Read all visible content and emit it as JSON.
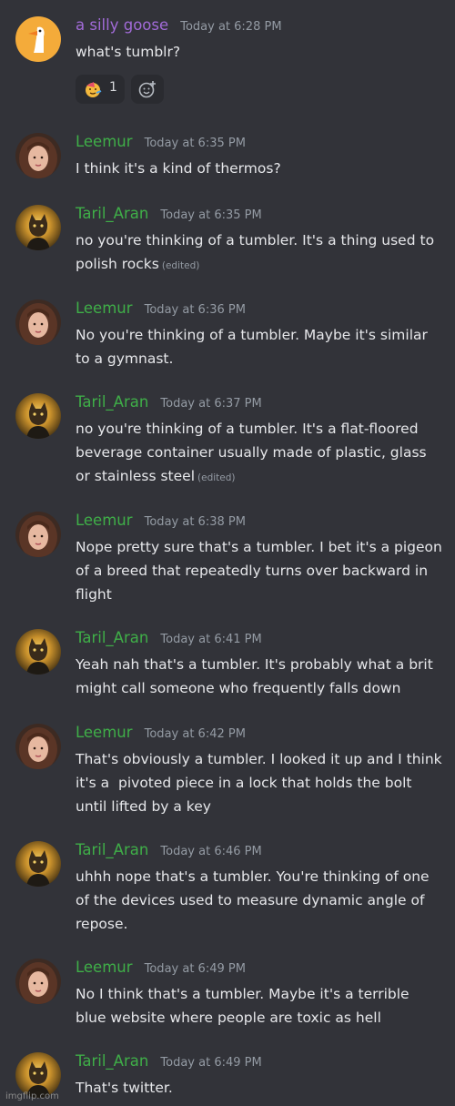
{
  "colors": {
    "background": "#323339",
    "name_goose": "#a26bd8",
    "name_green": "#3fae48",
    "text": "#e6e7ea",
    "timestamp": "#949ba4"
  },
  "messages": [
    {
      "author": "a silly goose",
      "avatar": "goose-avatar",
      "timestamp": "Today at 6:28 PM",
      "text": "what's tumblr?",
      "edited": "",
      "reactions": [
        {
          "emoji": "party-face-emoji",
          "count": "1"
        }
      ],
      "add_reaction_icon": "add-reaction-icon"
    },
    {
      "author": "Leemur",
      "avatar": "woman-avatar",
      "timestamp": "Today at 6:35 PM",
      "text": "I think it's a kind of thermos?",
      "edited": ""
    },
    {
      "author": "Taril_Aran",
      "avatar": "cat-avatar",
      "timestamp": "Today at 6:35 PM",
      "text": "no you're thinking of a tumbler. It's a thing used to\npolish rocks",
      "edited": "(edited)"
    },
    {
      "author": "Leemur",
      "avatar": "woman-avatar",
      "timestamp": "Today at 6:36 PM",
      "text": "No you're thinking of a tumbler. Maybe it's similar\nto a gymnast.",
      "edited": ""
    },
    {
      "author": "Taril_Aran",
      "avatar": "cat-avatar",
      "timestamp": "Today at 6:37 PM",
      "text": "no you're thinking of a tumbler. It's a flat-floored\nbeverage container usually made of plastic, glass\nor stainless steel",
      "edited": "(edited)"
    },
    {
      "author": "Leemur",
      "avatar": "woman-avatar",
      "timestamp": "Today at 6:38 PM",
      "text": "Nope pretty sure that's a tumbler. I bet it's a pigeon\nof a breed that repeatedly turns over backward in\nflight",
      "edited": ""
    },
    {
      "author": "Taril_Aran",
      "avatar": "cat-avatar",
      "timestamp": "Today at 6:41 PM",
      "text": "Yeah nah that's a tumbler. It's probably what a brit\nmight call someone who frequently falls down",
      "edited": ""
    },
    {
      "author": "Leemur",
      "avatar": "woman-avatar",
      "timestamp": "Today at 6:42 PM",
      "text": "That's obviously a tumbler. I looked it up and I think\nit's a  pivoted piece in a lock that holds the bolt\nuntil lifted by a key",
      "edited": ""
    },
    {
      "author": "Taril_Aran",
      "avatar": "cat-avatar",
      "timestamp": "Today at 6:46 PM",
      "text": "uhhh nope that's a tumbler. You're thinking of one\nof the devices used to measure dynamic angle of\nrepose.",
      "edited": ""
    },
    {
      "author": "Leemur",
      "avatar": "woman-avatar",
      "timestamp": "Today at 6:49 PM",
      "text": "No I think that's a tumbler. Maybe it's a terrible\nblue website where people are toxic as hell",
      "edited": ""
    },
    {
      "author": "Taril_Aran",
      "avatar": "cat-avatar",
      "timestamp": "Today at 6:49 PM",
      "text": "That's twitter.",
      "edited": ""
    }
  ],
  "watermark": "imgflip.com"
}
